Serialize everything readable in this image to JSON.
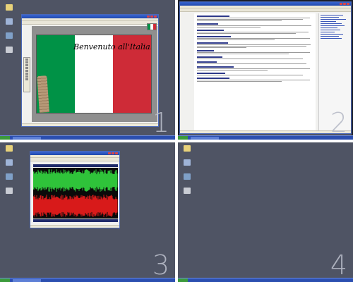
{
  "desktops": [
    {
      "number": "1",
      "active": false
    },
    {
      "number": "2",
      "active": true
    },
    {
      "number": "3",
      "active": false
    },
    {
      "number": "4",
      "active": false
    }
  ],
  "slide": {
    "title": "Benvenuto all'Italia...",
    "flag_colors": [
      "#009246",
      "#ffffff",
      "#ce2b37"
    ]
  },
  "colors": {
    "desktop": "#4f5464",
    "taskbar": "#2b4fb0",
    "wave_green": "#2fc33a",
    "wave_red": "#d81a1a"
  }
}
